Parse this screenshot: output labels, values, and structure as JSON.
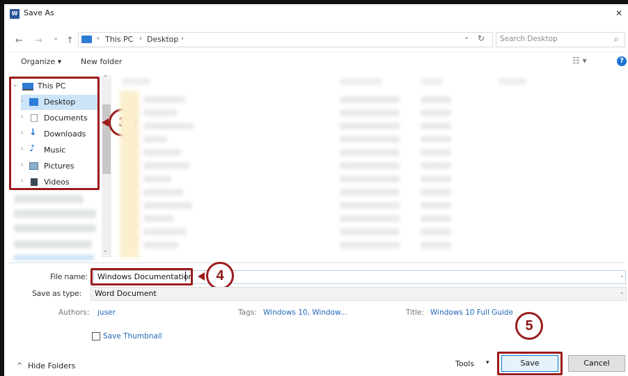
{
  "window": {
    "title": "Save As",
    "app_icon_text": "W",
    "close_glyph": "✕"
  },
  "nav": {
    "back_glyph": "←",
    "forward_glyph": "→",
    "recent_glyph": "⌄",
    "up_glyph": "↑",
    "breadcrumb": [
      "This PC",
      "Desktop"
    ],
    "separator_glyph": "›",
    "dropdown_glyph": "⌄",
    "refresh_glyph": "↻",
    "search_placeholder": "Search Desktop",
    "search_glyph": "⌕"
  },
  "toolbar": {
    "organize_label": "Organize ▾",
    "new_folder_label": "New folder",
    "view_glyph": "☷ ▾",
    "help_glyph": "?"
  },
  "tree": {
    "root_label": "This PC",
    "items": [
      {
        "label": "Desktop",
        "icon": "desktop-icon",
        "selected": true
      },
      {
        "label": "Documents",
        "icon": "documents-icon",
        "selected": false
      },
      {
        "label": "Downloads",
        "icon": "downloads-icon",
        "selected": false
      },
      {
        "label": "Music",
        "icon": "music-icon",
        "selected": false
      },
      {
        "label": "Pictures",
        "icon": "pictures-icon",
        "selected": false
      },
      {
        "label": "Videos",
        "icon": "videos-icon",
        "selected": false
      }
    ],
    "chevron_glyph": "›",
    "expand_glyph": "⌄",
    "scroll_up_glyph": "˄",
    "scroll_down_glyph": "˅"
  },
  "form": {
    "file_name_label": "File name:",
    "file_name_value": "Windows Documentation",
    "save_type_label": "Save as type:",
    "save_type_value": "Word Document",
    "authors_label": "Authors:",
    "authors_value": "juser",
    "tags_label": "Tags:",
    "tags_value": "Windows 10, Window...",
    "title_label": "Title:",
    "title_value": "Windows 10 Full Guide",
    "save_thumbnail_label": "Save Thumbnail"
  },
  "footer": {
    "hide_folders_label": "Hide Folders",
    "hide_glyph": "^",
    "tools_label": "Tools",
    "tools_glyph": "▾",
    "save_label": "Save",
    "cancel_label": "Cancel"
  },
  "callouts": [
    "3",
    "4",
    "5"
  ],
  "colors": {
    "accent_blue": "#0078d7",
    "callout_red": "#9b1b1b",
    "selection": "#cce4f7",
    "link_blue": "#2067b8"
  }
}
